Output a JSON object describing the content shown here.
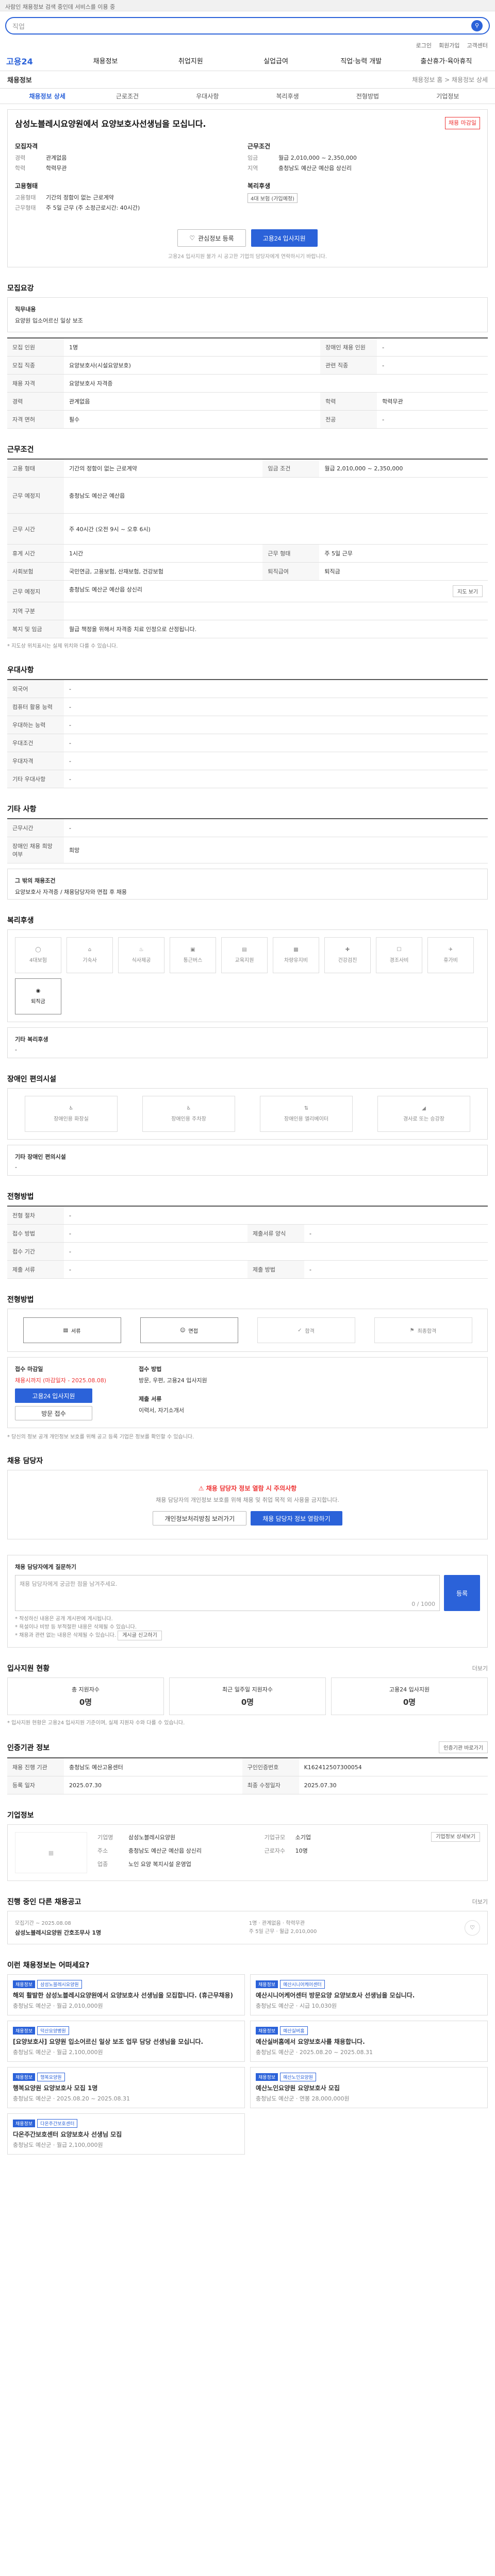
{
  "top": {
    "note": "사람인 채용정보 검색 중인데 서비스를 이용 중"
  },
  "search": {
    "placeholder": "직업"
  },
  "utility": [
    "로그인",
    "회원가입",
    "고객센터"
  ],
  "gnb": {
    "logo": "고용24",
    "menus": [
      "채용정보",
      "취업지원",
      "실업급여",
      "직업·능력 개발",
      "출산휴가·육아휴직"
    ]
  },
  "subbar": {
    "title": "채용정보",
    "right": "채용정보 홈 > 채용정보 상세"
  },
  "subtabs": [
    "채용정보 상세",
    "근로조건",
    "우대사항",
    "복리후생",
    "전형방법",
    "기업정보"
  ],
  "title": {
    "text": "삼성노블레시요양원에서 요양보호사선생님을 모십니다.",
    "badge": "채용 마감일"
  },
  "company": {
    "heading": "모집자격",
    "rows": [
      {
        "k": "경력",
        "v": "관계없음"
      },
      {
        "k": "학력",
        "v": "학력무관"
      }
    ]
  },
  "work": {
    "heading": "근무조건",
    "rows": [
      {
        "k": "임금",
        "v": "월급 2,010,000 ~ 2,350,000"
      },
      {
        "k": "지역",
        "v": "충청남도 예산군 예산읍 상신리"
      }
    ]
  },
  "emp": {
    "heading": "고용형태",
    "rows": [
      {
        "k": "고용형태",
        "v": "기간의 정함이 없는 근로계약"
      },
      {
        "k": "근무형태",
        "v": "주 5일 근무 (주 소정근로시간: 40시간)"
      }
    ]
  },
  "benefit": {
    "heading": "복리후생",
    "badge": "4대 보험 (가입예정)"
  },
  "buttons": {
    "scrap": "관심정보 등록",
    "apply": "고용24 입사지원"
  },
  "buttonnote": "고용24 입사지원 불가 시 공고한 기업의 담당자에게 연락하시기 바랍니다.",
  "recruit": {
    "heading": "모집요강",
    "duty_title": "직무내용",
    "duty_text": "요양원 입소어르신 일상 보조",
    "rows": [
      {
        "k1": "모집 인원",
        "v1": "1명",
        "k2": "장애인 채용 인원",
        "v2": "-"
      },
      {
        "k1": "모집 직종",
        "v1": "요양보호사(시설요양보호)",
        "k2": "관련 직종",
        "v2": "-"
      },
      {
        "k1": "채용 자격",
        "v1": "요양보호사 자격증",
        "k2": "",
        "v2": ""
      },
      {
        "k1": "경력",
        "v1": "관계없음",
        "k2": "학력",
        "v2": "학력무관"
      },
      {
        "k1": "자격 면허",
        "v1": "필수",
        "k2": "전공",
        "v2": "-"
      }
    ]
  },
  "condition": {
    "heading": "근무조건",
    "rows": [
      {
        "k1": "고용 형태",
        "v1": "기간의 정함이 없는 근로계약",
        "k2": "임금 조건",
        "v2": "월급 2,010,000 ~ 2,350,000"
      },
      {
        "k1": "근무 예정지",
        "v1": "충청남도 예산군 예산읍",
        "k2": "",
        "v2": ""
      },
      {
        "k1": "근무 시간",
        "v1": "주 40시간 (오전 9시 ~ 오후 6시)",
        "k2": "",
        "v2": ""
      },
      {
        "k1": "휴게 시간",
        "v1": "1시간",
        "k2": "근무 형태",
        "v2": "주 5일 근무"
      },
      {
        "k1": "사회보험",
        "v1": "국민연금, 고용보험, 산재보험, 건강보험",
        "k2": "퇴직급여",
        "v2": "퇴직금"
      },
      {
        "k1": "근무 예정지",
        "v1": "충청남도 예산군 예산읍 상신리",
        "k2": "",
        "v2": ""
      },
      {
        "k1": "지역 구분",
        "v1": "",
        "k2": "",
        "v2": ""
      },
      {
        "k1": "복지 및 임금",
        "v1": "월급 책정을 위해서 자격증 치료 인정으로 산정됩니다.",
        "k2": "",
        "v2": ""
      }
    ],
    "map_btn": "지도 보기",
    "note": "* 지도상 위치표시는 실제 위치와 다를 수 있습니다."
  },
  "prefer": {
    "heading": "우대사항",
    "rows": [
      {
        "k": "외국어",
        "v": "-"
      },
      {
        "k": "컴퓨터 활용 능력",
        "v": "-"
      },
      {
        "k": "우대하는 능력",
        "v": "-"
      },
      {
        "k": "우대조건",
        "v": "-"
      },
      {
        "k": "우대자격",
        "v": "-"
      },
      {
        "k": "기타 우대사항",
        "v": "-"
      }
    ]
  },
  "other": {
    "heading": "기타 사항",
    "rows": [
      {
        "k": "근무시간",
        "v": "-"
      },
      {
        "k": "장애인 채용 희망 여부",
        "v": "희망"
      }
    ],
    "box_title": "그 밖의 채용조건",
    "box_text": "요양보호사 자격증 / 채용담당자와 면접 후 채용"
  },
  "welfare": {
    "heading": "복리후생",
    "items": [
      "4대보험",
      "기숙사",
      "식사제공",
      "통근버스",
      "교육지원",
      "차량유지비",
      "건강검진",
      "경조사비",
      "휴가비",
      "퇴직금"
    ],
    "box_title": "기타 복리후생",
    "box_text": "-"
  },
  "disabled": {
    "heading": "장애인 편의시설",
    "items": [
      "장애인용 화장실",
      "장애인용 주차장",
      "장애인용 엘리베이터",
      "경사로 또는 승강장"
    ],
    "box_title": "기타 장애인 편의시설",
    "box_text": "-"
  },
  "process": {
    "heading": "전형방법",
    "rows": [
      {
        "k1": "전형 절차",
        "v1": "-",
        "k2": "",
        "v2": ""
      },
      {
        "k1": "접수 방법",
        "v1": "-",
        "k2": "제출서류 양식",
        "v2": "-"
      },
      {
        "k1": "접수 기간",
        "v1": "-",
        "k2": "",
        "v2": ""
      },
      {
        "k1": "제출 서류",
        "v1": "-",
        "k2": "제출 방법",
        "v2": "-"
      }
    ]
  },
  "apply_method": {
    "heading": "전형방법",
    "steps": [
      "서류",
      "면접",
      "합격",
      "최종합격"
    ],
    "label1": "접수 마감일",
    "deadline": "채용시까지 (마감일자 - 2025.08.08)",
    "btn_apply": "고용24 입사지원",
    "btn_visit": "방문 접수",
    "label2": "접수 방법",
    "method": "방문, 우편, 고용24 입사지원",
    "label3": "제출 서류",
    "docs": "이력서, 자기소개서"
  },
  "apply_note": "* 당신의 정보 공개 개인정보 보호를 위해 공고 등록 기업은 정보를 확인할 수 있습니다.",
  "contact": {
    "heading": "채용 담당자",
    "alert_title": "채용 담당자 정보 열람 시 주의사항",
    "alert_text": "채용 담당자의 개인정보 보호를 위해 채용 및 취업 목적 외 사용을 금지합니다.",
    "btn1": "개인정보처리방침 보러가기",
    "btn2": "채용 담당자 정보 열람하기"
  },
  "comment": {
    "heading": "채용 담당자에게 질문하기",
    "placeholder": "채용 담당자에게 궁금한 점을 남겨주세요.",
    "counter": "0 / 1000",
    "submit": "등록",
    "notes": [
      "* 작성하신 내용은 공개 게시판에 게시됩니다.",
      "* 욕설이나 비방 등 부적절한 내용은 삭제될 수 있습니다.",
      "* 채용과 관련 없는 내용은 삭제될 수 있습니다."
    ],
    "report": "게시글 신고하기"
  },
  "status": {
    "heading": "입사지원 현황",
    "link": "더보기",
    "items": [
      {
        "k": "총 지원자수",
        "v": "0명"
      },
      {
        "k": "최근 일주일 지원자수",
        "v": "0명"
      },
      {
        "k": "고용24 입사지원",
        "v": "0명"
      }
    ],
    "note": "* 입사지원 현황은 고용24 입사지원 기준이며, 실제 지원자 수와 다를 수 있습니다."
  },
  "reginfo": {
    "heading": "인증기관 정보",
    "link": "인증기관 바로가기",
    "rows": [
      {
        "k1": "채용 진행 기관",
        "v1": "충청남도 예산고용센터",
        "k2": "구인인증번호",
        "v2": "K162412507300054"
      },
      {
        "k1": "등록 일자",
        "v1": "2025.07.30",
        "k2": "최종 수정일자",
        "v2": "2025.07.30"
      }
    ]
  },
  "coinfo": {
    "heading": "기업정보",
    "name_k": "기업명",
    "name_v": "삼성노블레시요양원",
    "size_k": "기업규모",
    "size_v": "소기업",
    "addr_k": "주소",
    "addr_v": "충청남도 예산군 예산읍 상신리",
    "type_k": "업종",
    "type_v": "노인 요양 복지시설 운영업",
    "emp_k": "근로자수",
    "emp_v": "10명",
    "btn": "기업정보 상세보기"
  },
  "other_jobs": {
    "heading": "진행 중인 다른 채용공고",
    "link": "더보기",
    "date": "모집기간 ~ 2025.08.08",
    "title": "삼성노블레시요양원 간호조무사 1명",
    "meta": [
      "1명",
      "관계없음",
      "학력무관",
      "주 5일 근무",
      "월급 2,010,000"
    ]
  },
  "recommend": {
    "heading": "이런 채용정보는 어떠세요?",
    "cards": [
      {
        "tag": "채용정보",
        "co": "삼성노블레시요양원",
        "title": "해외 활발한 삼성노블레시요양원에서 요양보호사 선생님을 모집합니다. (휴근무채용)",
        "meta": "충청남도 예산군 · 월급 2,010,000원"
      },
      {
        "tag": "채용정보",
        "co": "예산시니어케어센터",
        "title": "예산시니어케어센터 방문요양 요양보호사 선생님을 모십니다.",
        "meta": "충청남도 예산군 · 시급 10,030원"
      },
      {
        "tag": "채용정보",
        "co": "덕산요양병원",
        "title": "[요양보호사] 요양원 입소어르신 일상 보조 업무 담당 선생님을 모십니다.",
        "meta": "충청남도 예산군 · 월급 2,100,000원"
      },
      {
        "tag": "채용정보",
        "co": "예산실버홈",
        "title": "예산실버홈에서 요양보호사를 채용합니다.",
        "meta": "충청남도 예산군 · 2025.08.20 ~ 2025.08.31"
      },
      {
        "tag": "채용정보",
        "co": "행복요양원",
        "title": "행복요양원 요양보호사 모집 1명",
        "meta": "충청남도 예산군 · 2025.08.20 ~ 2025.08.31"
      },
      {
        "tag": "채용정보",
        "co": "예산노인요양원",
        "title": "예산노인요양원 요양보호사 모집",
        "meta": "충청남도 예산군 · 연봉 28,000,000원"
      },
      {
        "tag": "채용정보",
        "co": "다온주간보호센터",
        "title": "다온주간보호센터 요양보호사 선생님 모집",
        "meta": "충청남도 예산군 · 월급 2,100,000원"
      }
    ]
  }
}
